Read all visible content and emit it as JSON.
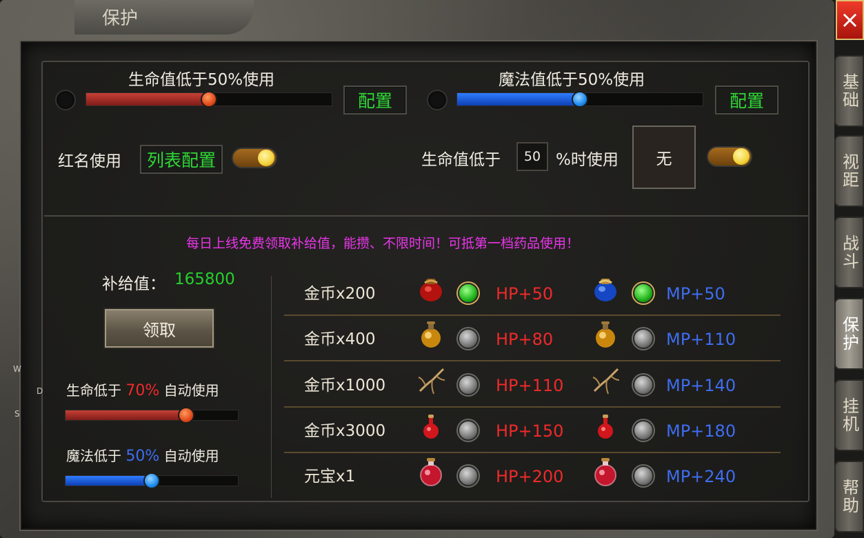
{
  "window": {
    "title": "保护",
    "close_icon": "×"
  },
  "side_tabs": [
    {
      "label": "基础",
      "active": false
    },
    {
      "label": "视距",
      "active": false
    },
    {
      "label": "战斗",
      "active": false
    },
    {
      "label": "保护",
      "active": true
    },
    {
      "label": "挂机",
      "active": false
    },
    {
      "label": "帮助",
      "active": false
    }
  ],
  "hp_use": {
    "label": "生命值低于50%使用",
    "percent": 50,
    "config_label": "配置"
  },
  "mp_use": {
    "label": "魔法值低于50%使用",
    "percent": 50,
    "config_label": "配置"
  },
  "red_name": {
    "label": "红名使用",
    "list_config_label": "列表配置",
    "enabled": true
  },
  "hp_item": {
    "prefix": "生命值低于",
    "value": "50",
    "suffix": "%时使用",
    "slot_text": "无",
    "enabled": true
  },
  "notice": "每日上线免费领取补给值，能攒、不限时间！可抵第一档药品使用！",
  "supply": {
    "label": "补给值：",
    "value": "165800",
    "claim_label": "领取"
  },
  "auto_hp": {
    "prefix": "生命低于",
    "value": "70%",
    "suffix": "自动使用",
    "percent": 70
  },
  "auto_mp": {
    "prefix": "魔法低于",
    "value": "50%",
    "suffix": "自动使用",
    "percent": 50
  },
  "potion_rows": [
    {
      "cost": "金币x200",
      "hp_icon": "red-pot-icon",
      "hp_selected": true,
      "hp": "HP+50",
      "mp_icon": "blue-pot-icon",
      "mp_selected": true,
      "mp": "MP+50"
    },
    {
      "cost": "金币x400",
      "hp_icon": "gold-flask-icon",
      "hp_selected": false,
      "hp": "HP+80",
      "mp_icon": "gold-flask-icon",
      "mp_selected": false,
      "mp": "MP+110"
    },
    {
      "cost": "金币x1000",
      "hp_icon": "ginseng-root-icon",
      "hp_selected": false,
      "hp": "HP+110",
      "mp_icon": "ginseng-root-icon",
      "mp_selected": false,
      "mp": "MP+140"
    },
    {
      "cost": "金币x3000",
      "hp_icon": "small-red-flask-icon",
      "hp_selected": false,
      "hp": "HP+150",
      "mp_icon": "small-red-flask-icon",
      "mp_selected": false,
      "mp": "MP+180"
    },
    {
      "cost": "元宝x1",
      "hp_icon": "large-red-flask-icon",
      "hp_selected": false,
      "hp": "HP+200",
      "mp_icon": "large-red-flask-icon",
      "mp_selected": false,
      "mp": "MP+240"
    }
  ],
  "compass": {
    "w": "W",
    "d": "D",
    "s": "S"
  },
  "colors": {
    "hp": "#ee2a2a",
    "mp": "#3e6df0",
    "green": "#25d02c",
    "notice": "#ea35ea"
  }
}
